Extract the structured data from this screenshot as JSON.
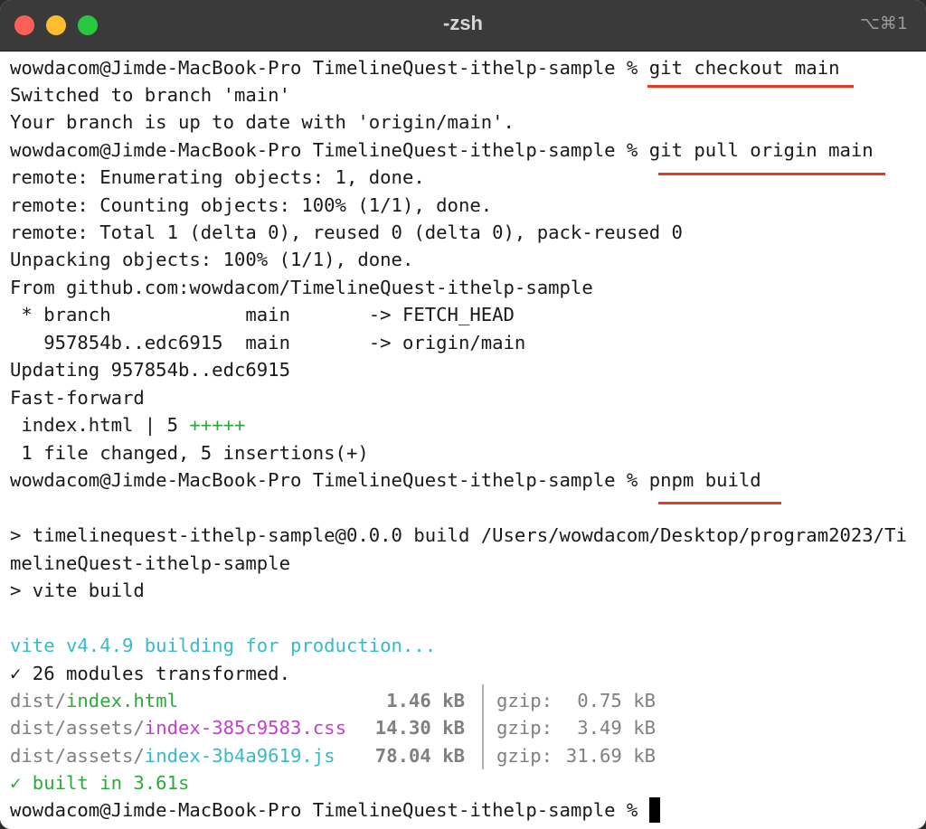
{
  "window": {
    "title": "-zsh",
    "shortcut": "⌥⌘1"
  },
  "colors": {
    "underline": "#e03d22",
    "green": "#2eaa3a",
    "cyan": "#39b9c9",
    "magenta": "#c43fcc"
  },
  "terminal": {
    "prompt": "wowdacom@Jimde-MacBook-Pro TimelineQuest-ithelp-sample % ",
    "cmd1": "git checkout main",
    "out1": "Switched to branch 'main'",
    "out2": "Your branch is up to date with 'origin/main'.",
    "cmd2": "git pull origin main",
    "out3": "remote: Enumerating objects: 1, done.",
    "out4": "remote: Counting objects: 100% (1/1), done.",
    "out5": "remote: Total 1 (delta 0), reused 0 (delta 0), pack-reused 0",
    "out6": "Unpacking objects: 100% (1/1), done.",
    "out7": "From github.com:wowdacom/TimelineQuest-ithelp-sample",
    "out8": " * branch            main       -> FETCH_HEAD",
    "out9": "   957854b..edc6915  main       -> origin/main",
    "out10": "Updating 957854b..edc6915",
    "out11": "Fast-forward",
    "out12": " index.html | 5 ",
    "out12_plus": "+++++",
    "out13": " 1 file changed, 5 insertions(+)",
    "cmd3": "pnpm build",
    "out14": "> timelinequest-ithelp-sample@0.0.0 build /Users/wowdacom/Desktop/program2023/Ti",
    "out15": "melineQuest-ithelp-sample",
    "out16": "> vite build",
    "vite_building": "vite v4.4.9 building for production...",
    "modules": "✓ 26 modules transformed.",
    "files": [
      {
        "dir": "dist/",
        "name": "index.html",
        "size": "1.46 kB",
        "gzip_label": "gzip:",
        "gzip": "0.75 kB"
      },
      {
        "dir": "dist/assets/",
        "name": "index-385c9583.css",
        "size": "14.30 kB",
        "gzip_label": "gzip:",
        "gzip": "3.49 kB"
      },
      {
        "dir": "dist/assets/",
        "name": "index-3b4a9619.js",
        "size": "78.04 kB",
        "gzip_label": "gzip:",
        "gzip": "31.69 kB"
      }
    ],
    "built": "✓ built in 3.61s"
  }
}
